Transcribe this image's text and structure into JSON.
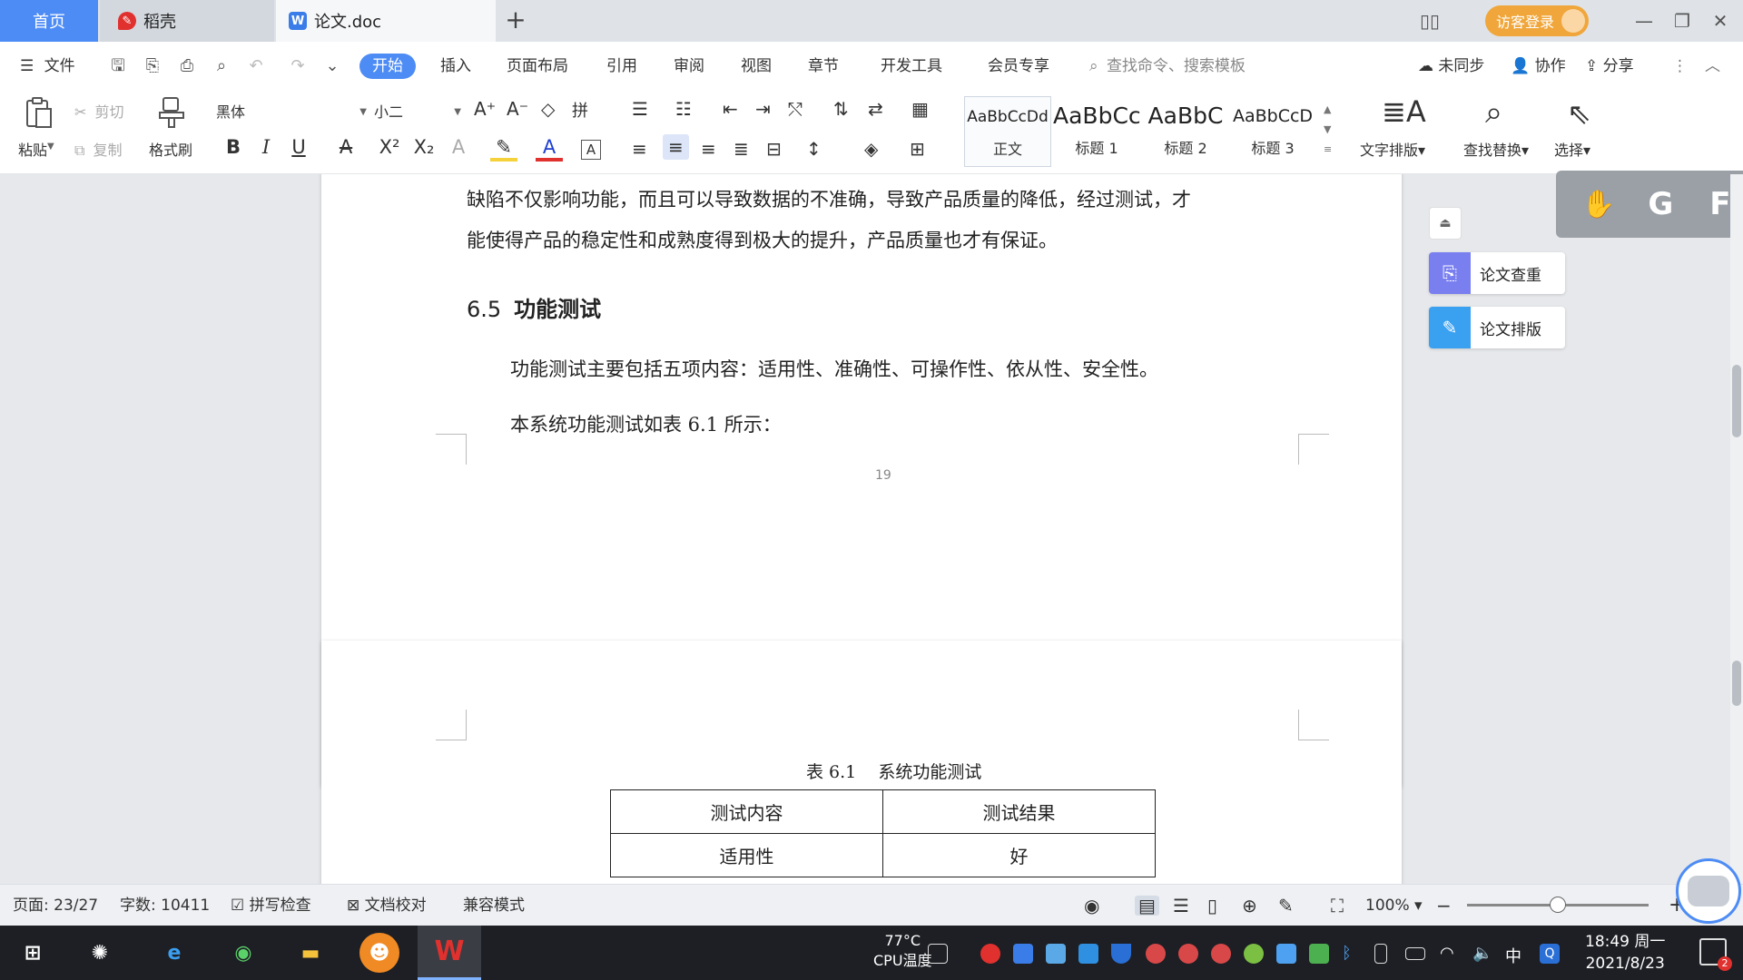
{
  "tabs": {
    "home": "首页",
    "daoke": "稻壳",
    "doc": "论文.doc",
    "add": "+"
  },
  "titlebar": {
    "login": "访客登录",
    "minimize": "—",
    "restore": "❐",
    "close": "✕"
  },
  "menu": {
    "file": "文件",
    "items": [
      "开始",
      "插入",
      "页面布局",
      "引用",
      "审阅",
      "视图",
      "章节",
      "开发工具",
      "会员专享"
    ],
    "search_placeholder": "查找命令、搜索模板",
    "sync": "未同步",
    "collab": "协作",
    "share": "分享"
  },
  "ribbon": {
    "paste": "粘贴",
    "cut": "剪切",
    "copy": "复制",
    "format_painter": "格式刷",
    "font_name": "黑体",
    "font_size": "小二",
    "styles": [
      {
        "sample": "AaBbCcDd",
        "name": "正文"
      },
      {
        "sample": "AaBbCc",
        "name": "标题 1"
      },
      {
        "sample": "AaBbC",
        "name": "标题 2"
      },
      {
        "sample": "AaBbCcD",
        "name": "标题 3"
      }
    ],
    "text_layout": "文字排版",
    "find_replace": "查找替换",
    "select": "选择"
  },
  "document": {
    "line1": "缺陷不仅影响功能，而且可以导致数据的不准确，导致产品质量的降低，经过测试，才",
    "line2": "能使得产品的稳定性和成熟度得到极大的提升，产品质量也才有保证。",
    "heading_num": "6.5",
    "heading_text": "功能测试",
    "para1": "功能测试主要包括五项内容：适用性、准确性、可操作性、依从性、安全性。",
    "para2": "本系统功能测试如表 6.1 所示：",
    "page_number": "19",
    "table_caption": "表 6.1    系统功能测试",
    "table_header": [
      "测试内容",
      "测试结果"
    ],
    "table_row1": [
      "适用性",
      "好"
    ]
  },
  "side_panel": {
    "check": "论文查重",
    "layout": "论文排版"
  },
  "status": {
    "page": "页面: 23/27",
    "words": "字数: 10411",
    "spell": "拼写检查",
    "proof": "文档校对",
    "compat": "兼容模式",
    "zoom": "100%",
    "zoom_level": 0.5
  },
  "taskbar": {
    "temp": "77°C",
    "cpu": "CPU温度",
    "lang": "中",
    "time": "18:49 周一",
    "date": "2021/8/23",
    "notif_count": "2"
  },
  "colors": {
    "accent": "#4d8cf5",
    "login": "#f0a63a",
    "wps_red": "#e0312e"
  }
}
